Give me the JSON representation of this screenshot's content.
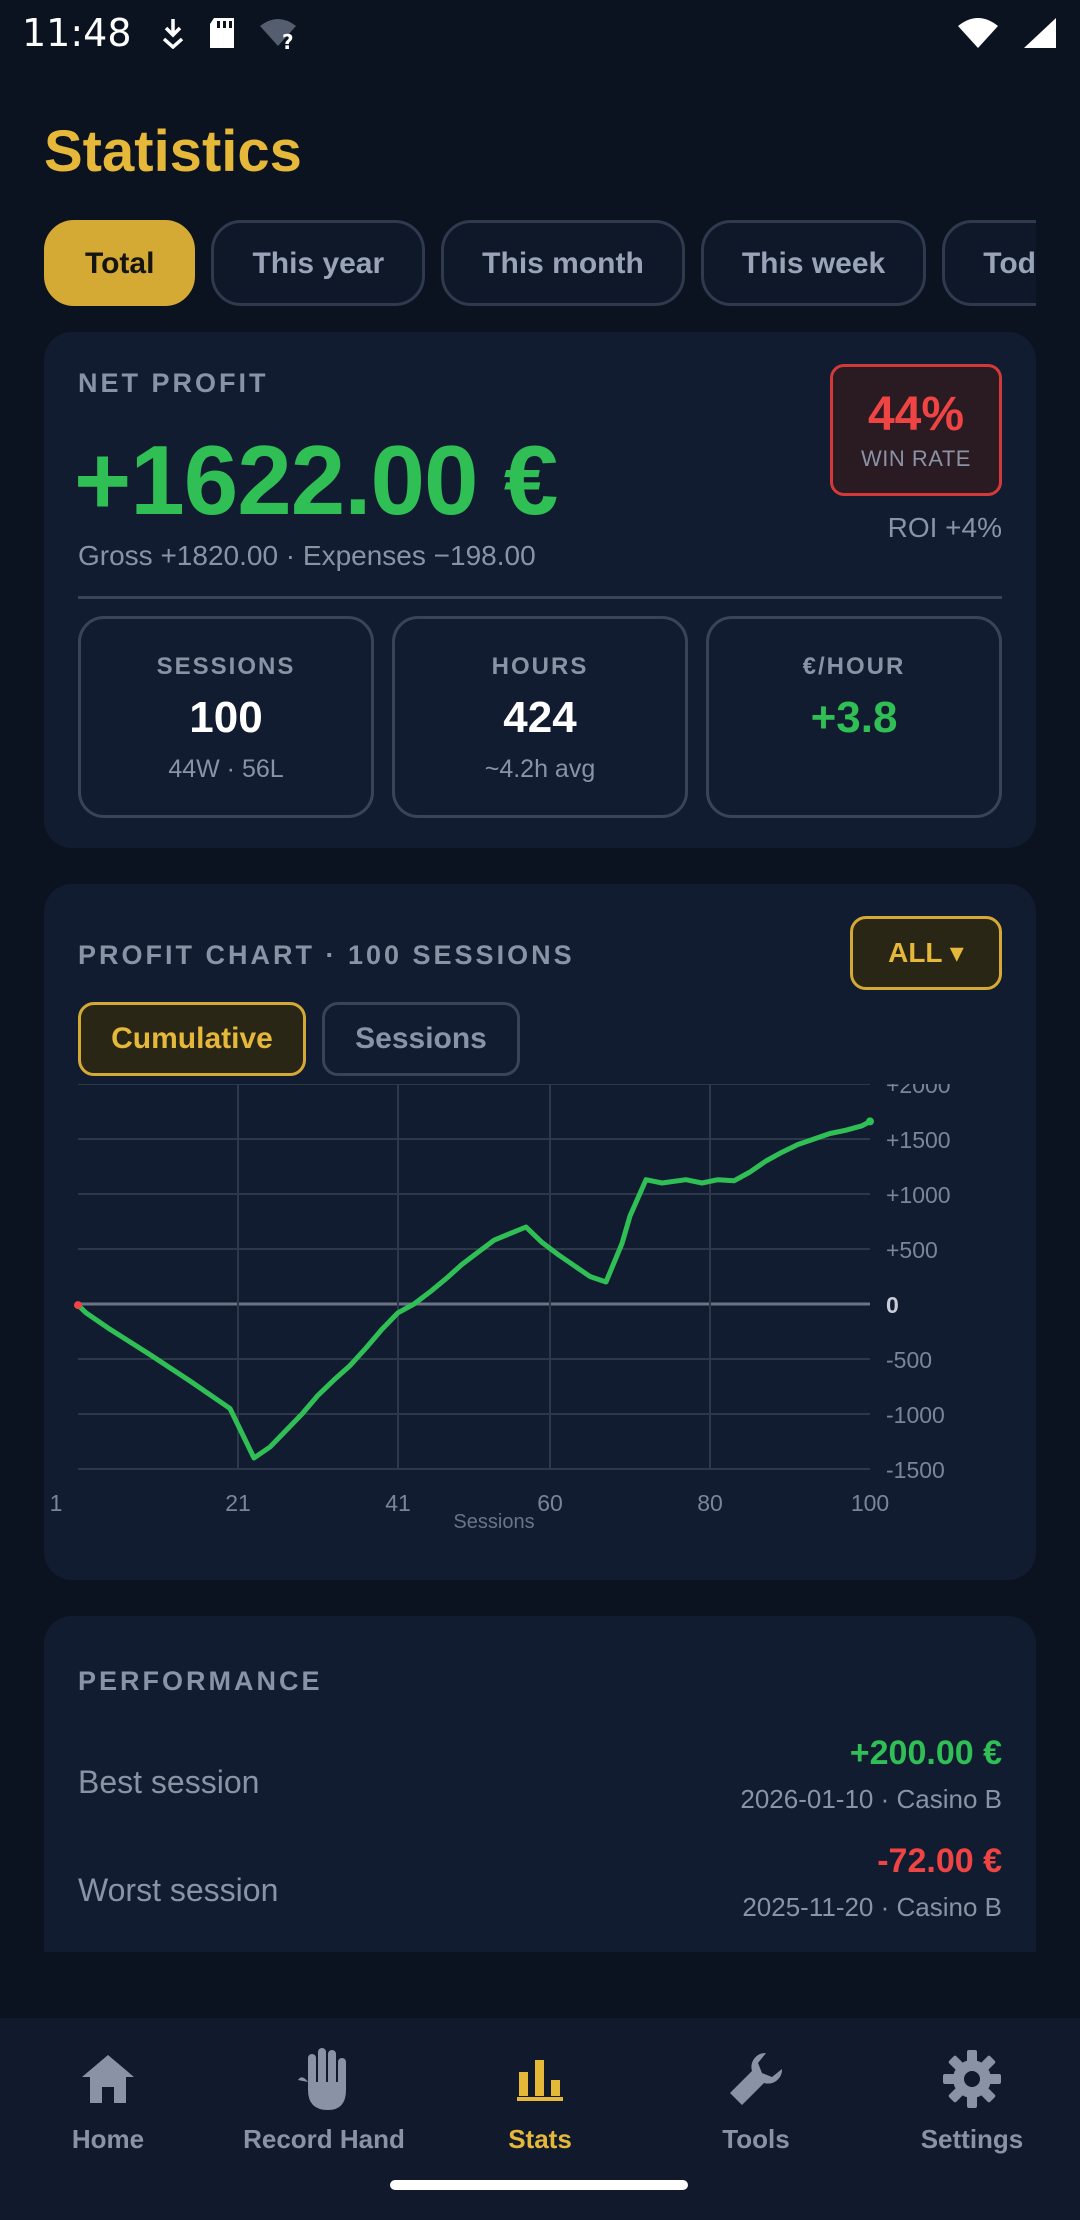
{
  "status_bar": {
    "time": "11:48"
  },
  "title": "Statistics",
  "periods": [
    "Total",
    "This year",
    "This month",
    "This week",
    "Today"
  ],
  "net_profit": {
    "label": "NET PROFIT",
    "value": "+1622.00 €",
    "sub": "Gross +1820.00 · Expenses −198.00",
    "win_rate": "44%",
    "win_rate_label": "WIN RATE",
    "roi": "ROI +4%"
  },
  "stats": [
    {
      "label": "SESSIONS",
      "value": "100",
      "sub": "44W · 56L"
    },
    {
      "label": "HOURS",
      "value": "424",
      "sub": "~4.2h avg"
    },
    {
      "label": "€/HOUR",
      "value": "+3.8",
      "sub": ""
    }
  ],
  "chart_card": {
    "label": "PROFIT CHART · 100 SESSIONS",
    "filter": "ALL ▾",
    "toggle_cumulative": "Cumulative",
    "toggle_sessions": "Sessions"
  },
  "chart_data": {
    "type": "line",
    "xlabel": "Sessions",
    "ylim": [
      -1500,
      2000
    ],
    "y_ticks": [
      "+2000",
      "+1500",
      "+1000",
      "+500",
      "0",
      "-500",
      "-1000",
      "-1500"
    ],
    "y_tick_values": [
      2000,
      1500,
      1000,
      500,
      0,
      -500,
      -1000,
      -1500
    ],
    "x_ticks": [
      "1",
      "21",
      "41",
      "60",
      "80",
      "100"
    ],
    "x_tick_values": [
      1,
      21,
      41,
      60,
      80,
      100
    ],
    "series": [
      {
        "x": [
          1,
          2,
          5,
          10,
          15,
          20,
          23,
          25,
          27,
          29,
          31,
          33,
          35,
          37,
          39,
          41,
          43,
          45,
          47,
          49,
          51,
          53,
          55,
          57,
          59,
          61,
          63,
          65,
          67,
          69,
          70,
          72,
          74,
          75,
          77,
          79,
          81,
          83,
          85,
          87,
          89,
          91,
          93,
          95,
          97,
          99,
          100
        ],
        "y": [
          -10,
          -80,
          -230,
          -460,
          -700,
          -950,
          -1400,
          -1300,
          -1150,
          -1000,
          -830,
          -690,
          -560,
          -400,
          -230,
          -80,
          0,
          110,
          230,
          360,
          470,
          580,
          640,
          700,
          560,
          450,
          350,
          250,
          200,
          550,
          800,
          1130,
          1100,
          1110,
          1130,
          1100,
          1130,
          1120,
          1200,
          1300,
          1380,
          1450,
          1500,
          1550,
          1580,
          1620,
          1660
        ]
      }
    ]
  },
  "performance": {
    "label": "PERFORMANCE",
    "rows": [
      {
        "name": "Best session",
        "value": "+200.00 €",
        "meta": "2026-01-10 · Casino B"
      },
      {
        "name": "Worst session",
        "value": "-72.00 €",
        "meta": "2025-11-20 · Casino B"
      }
    ]
  },
  "nav": [
    "Home",
    "Record Hand",
    "Stats",
    "Tools",
    "Settings"
  ],
  "colors": {
    "accent": "#e5b83a",
    "positive": "#2fbf55",
    "negative": "#ef4444",
    "background": "#0b1220",
    "card": "#121c30"
  }
}
